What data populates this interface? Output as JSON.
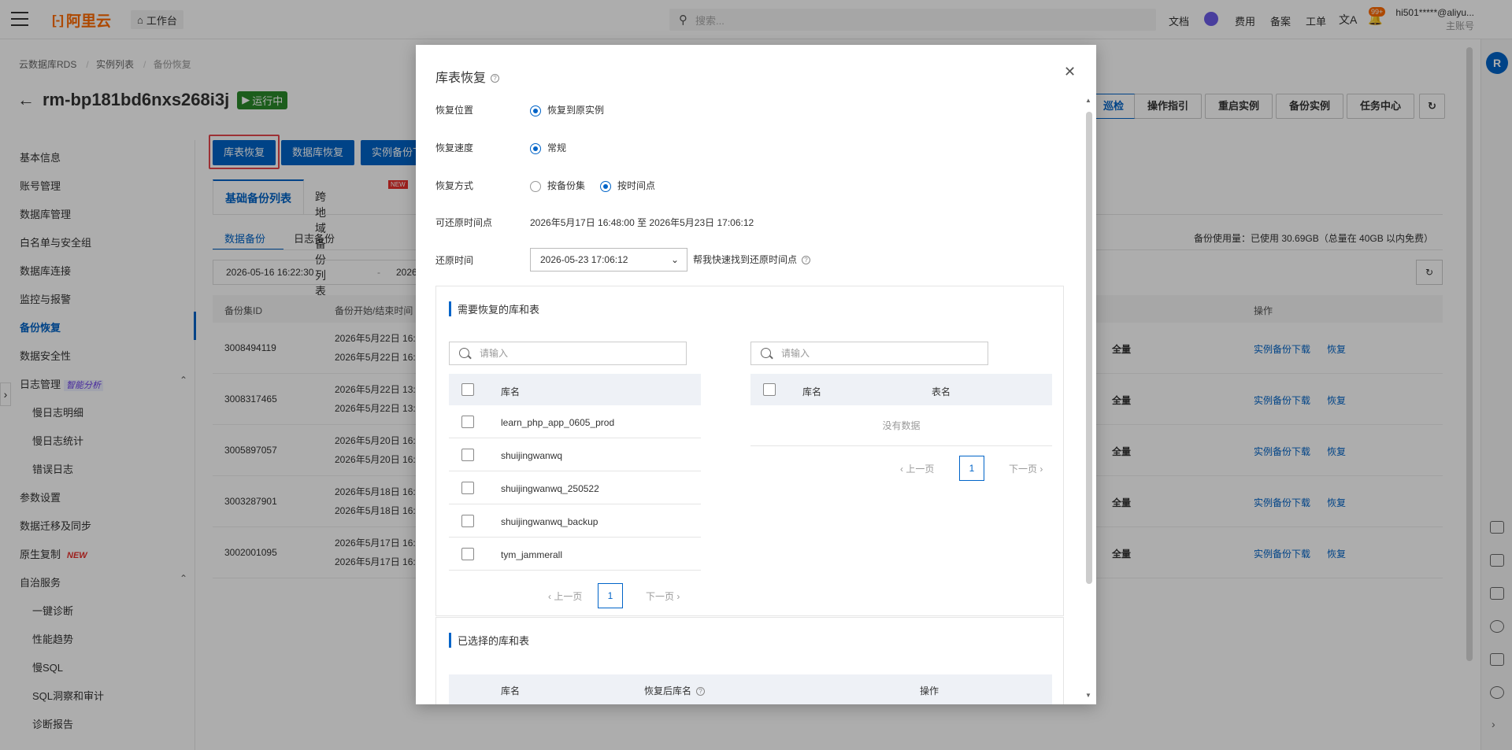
{
  "header": {
    "logo": "阿里云",
    "workspace": "工作台",
    "search_placeholder": "搜索...",
    "nav": [
      "文档",
      "费用",
      "备案",
      "工单"
    ],
    "notif_badge": "99+",
    "account": "hi501*****@aliyu...",
    "account_role": "主账号"
  },
  "breadcrumb": [
    "云数据库RDS",
    "实例列表",
    "备份恢复"
  ],
  "instance": {
    "id": "rm-bp181bd6nxs268i3j",
    "status": "运行中"
  },
  "top_buttons": [
    "操作指引",
    "重启实例",
    "备份实例",
    "任务中心"
  ],
  "sidebar": {
    "items": [
      {
        "label": "基本信息"
      },
      {
        "label": "账号管理"
      },
      {
        "label": "数据库管理"
      },
      {
        "label": "白名单与安全组"
      },
      {
        "label": "数据库连接"
      },
      {
        "label": "监控与报警"
      },
      {
        "label": "备份恢复"
      },
      {
        "label": "数据安全性"
      },
      {
        "label": "日志管理",
        "tag": "智能分析"
      },
      {
        "label": "慢日志明细"
      },
      {
        "label": "慢日志统计"
      },
      {
        "label": "错误日志"
      },
      {
        "label": "参数设置"
      },
      {
        "label": "数据迁移及同步"
      },
      {
        "label": "原生复制",
        "new": "NEW"
      },
      {
        "label": "自治服务"
      },
      {
        "label": "一键诊断"
      },
      {
        "label": "性能趋势"
      },
      {
        "label": "慢SQL"
      },
      {
        "label": "SQL洞察和审计"
      },
      {
        "label": "诊断报告"
      }
    ]
  },
  "actions": {
    "btn1": "库表恢复",
    "btn2": "数据库恢复",
    "btn3": "实例备份下"
  },
  "tabs": {
    "t1": "基础备份列表",
    "t2": "跨地域备份列表",
    "new": "NEW"
  },
  "subtabs": {
    "s1": "数据备份",
    "s2": "日志备份"
  },
  "date_range": {
    "start": "2026-05-16 16:22:30",
    "end": "2026"
  },
  "usage": "备份使用量：已使用 30.69GB（总量在 40GB 以内免费）",
  "table": {
    "headers": {
      "id": "备份集ID",
      "time": "备份开始/结束时间",
      "op": "操作"
    },
    "rows": [
      {
        "id": "3008494119",
        "t1": "2026年5月22日 16:",
        "t2": "2026年5月22日 16:",
        "type": "全量"
      },
      {
        "id": "3008317465",
        "t1": "2026年5月22日 13:",
        "t2": "2026年5月22日 13:",
        "type": "全量"
      },
      {
        "id": "3005897057",
        "t1": "2026年5月20日 16:",
        "t2": "2026年5月20日 16:",
        "type": "全量"
      },
      {
        "id": "3003287901",
        "t1": "2026年5月18日 16:",
        "t2": "2026年5月18日 16:",
        "type": "全量"
      },
      {
        "id": "3002001095",
        "t1": "2026年5月17日 16:",
        "t2": "2026年5月17日 16:",
        "type": "全量"
      }
    ],
    "op_download": "实例备份下载",
    "op_restore": "恢复"
  },
  "modal": {
    "title": "库表恢复",
    "location_label": "恢复位置",
    "location_value": "恢复到原实例",
    "speed_label": "恢复速度",
    "speed_value": "常规",
    "method_label": "恢复方式",
    "method_opt1": "按备份集",
    "method_opt2": "按时间点",
    "range_label": "可还原时间点",
    "range_value": "2026年5月17日 16:48:00 至 2026年5月23日 17:06:12",
    "restore_time_label": "还原时间",
    "restore_time_value": "2026-05-23 17:06:12",
    "help_link": "帮我快速找到还原时间点",
    "section1": "需要恢复的库和表",
    "search_placeholder": "请输入",
    "left_col": "库名",
    "databases": [
      "learn_php_app_0605_prod",
      "shuijingwanwq",
      "shuijingwanwq_250522",
      "shuijingwanwq_backup",
      "tym_jammerall"
    ],
    "right_col1": "库名",
    "right_col2": "表名",
    "empty": "没有数据",
    "prev": "上一页",
    "next": "下一页",
    "page": "1",
    "section2": "已选择的库和表",
    "sel_col1": "库名",
    "sel_col2": "恢复后库名",
    "sel_col3": "操作"
  }
}
